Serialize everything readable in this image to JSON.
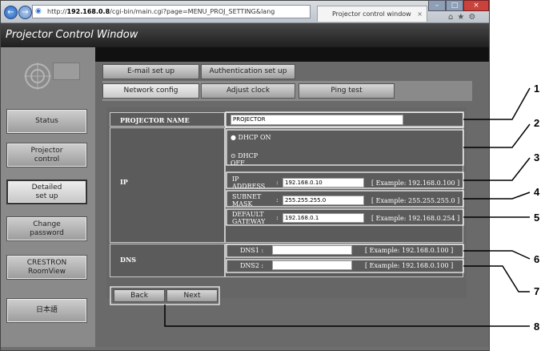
{
  "browser": {
    "url_prefix": "http://",
    "url_host": "192.168.0.8",
    "url_path": "/cgi-bin/main.cgi?page=MENU_PROJ_SETTING&lang",
    "tab_title": "Projector control window"
  },
  "app": {
    "title": "Projector Control Window"
  },
  "sidebar": {
    "items": [
      {
        "label": "Status"
      },
      {
        "label": "Projector\ncontrol"
      },
      {
        "label": "Detailed\nset up"
      },
      {
        "label": "Change\npassword"
      },
      {
        "label": "CRESTRON\nRoomView"
      },
      {
        "label": "日本語"
      }
    ]
  },
  "tabs": {
    "email": "E-mail set up",
    "auth": "Authentication set up",
    "network": "Network config",
    "clock": "Adjust clock",
    "ping": "Ping test"
  },
  "form": {
    "projector_name_label": "PROJECTOR NAME",
    "projector_name_value": "PROJECTOR",
    "ip_label": "IP",
    "dhcp_on": "DHCP ON",
    "dhcp_off": "DHCP\nOFF",
    "ip_address_label": "IP\nADDRESS",
    "ip_address_value": "192.168.0.10",
    "ip_example": "[ Example: 192.168.0.100 ]",
    "subnet_label": "SUBNET\nMASK",
    "subnet_value": "255.255.255.0",
    "subnet_example": "[ Example: 255.255.255.0 ]",
    "gateway_label": "DEFAULT\nGATEWAY",
    "gateway_value": "192.168.0.1",
    "gateway_example": "[ Example: 192.168.0.254 ]",
    "dns_label": "DNS",
    "dns1_label": "DNS1 :",
    "dns1_value": "",
    "dns1_example": "[ Example: 192.168.0.100 ]",
    "dns2_label": "DNS2 :",
    "dns2_value": "",
    "dns2_example": "[ Example: 192.168.0.100 ]",
    "sep": ":"
  },
  "buttons": {
    "back": "Back",
    "next": "Next"
  },
  "callouts": [
    "1",
    "2",
    "3",
    "4",
    "5",
    "6",
    "7",
    "8"
  ],
  "colors": {
    "frame_dark": "#1f1f1f",
    "panel": "#666666",
    "callout": "#000000"
  }
}
